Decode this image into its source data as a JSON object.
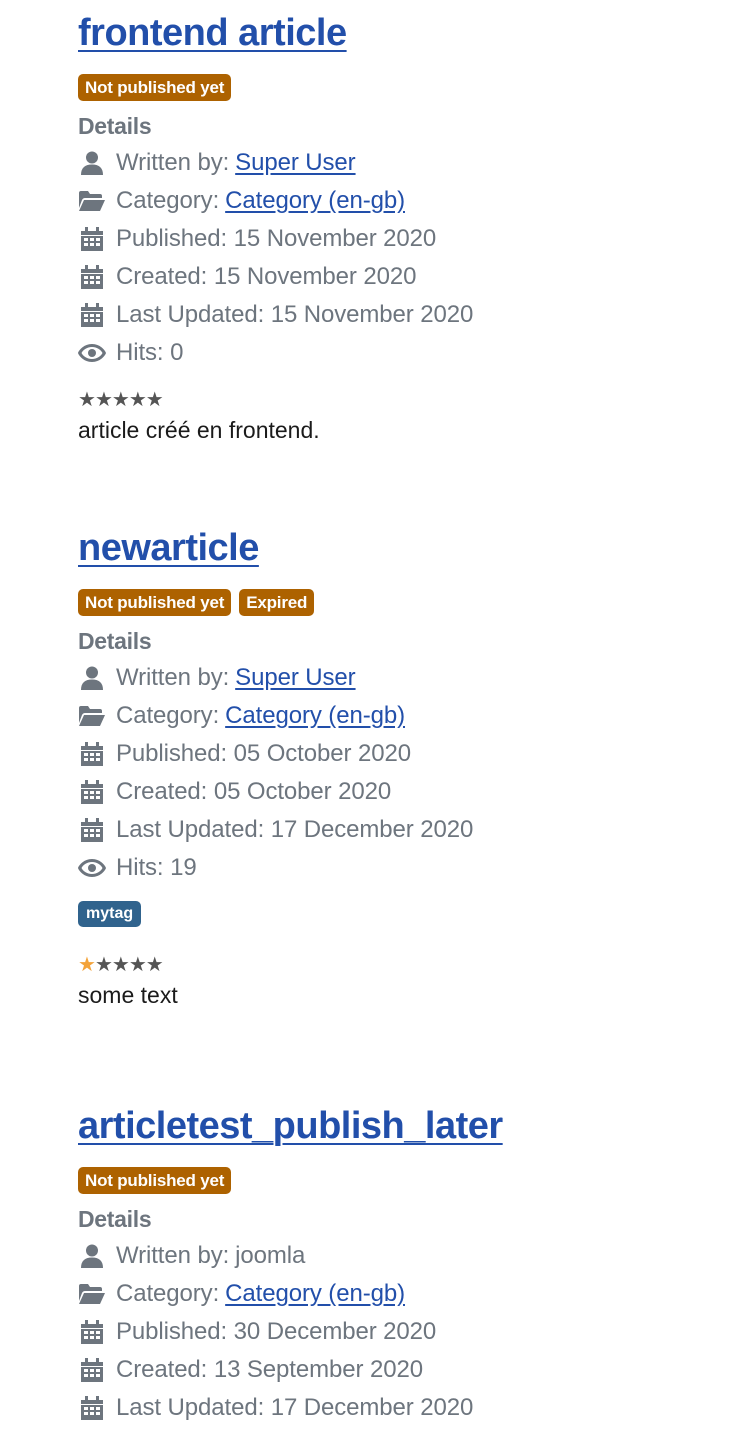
{
  "articles": [
    {
      "title": "frontend article",
      "badges": [
        "Not published yet"
      ],
      "details_label": "Details",
      "author_label": "Written by:",
      "author": "Super User",
      "category_label": "Category:",
      "category": "Category (en-gb)",
      "published": "Published: 15 November 2020",
      "created": "Created: 15 November 2020",
      "updated": "Last Updated: 15 November 2020",
      "hits": "Hits: 0",
      "rating": 0,
      "intro": "article créé en frontend."
    },
    {
      "title": "newarticle",
      "badges": [
        "Not published yet",
        "Expired"
      ],
      "details_label": "Details",
      "author_label": "Written by:",
      "author": "Super User",
      "category_label": "Category:",
      "category": "Category (en-gb)",
      "published": "Published: 05 October 2020",
      "created": "Created: 05 October 2020",
      "updated": "Last Updated: 17 December 2020",
      "hits": "Hits: 19",
      "tag": "mytag",
      "rating": 1,
      "intro": "some text"
    },
    {
      "title": "articletest_publish_later",
      "badges": [
        "Not published yet"
      ],
      "details_label": "Details",
      "author_label": "Written by:",
      "author": "joomla",
      "category_label": "Category:",
      "category": "Category (en-gb)",
      "published": "Published: 30 December 2020",
      "created": "Created: 13 September 2020",
      "updated": "Last Updated: 17 December 2020"
    }
  ],
  "colors": {
    "title_link": "#224faa",
    "badge_bg": "#ad6200",
    "tag_bg": "#30638d",
    "meta_text": "#6d757e",
    "star_on": "#f3a33a"
  },
  "icons": {
    "author": "user-icon",
    "category": "folder-open-icon",
    "date": "calendar-icon",
    "hits": "eye-icon"
  },
  "rating_max": 5
}
